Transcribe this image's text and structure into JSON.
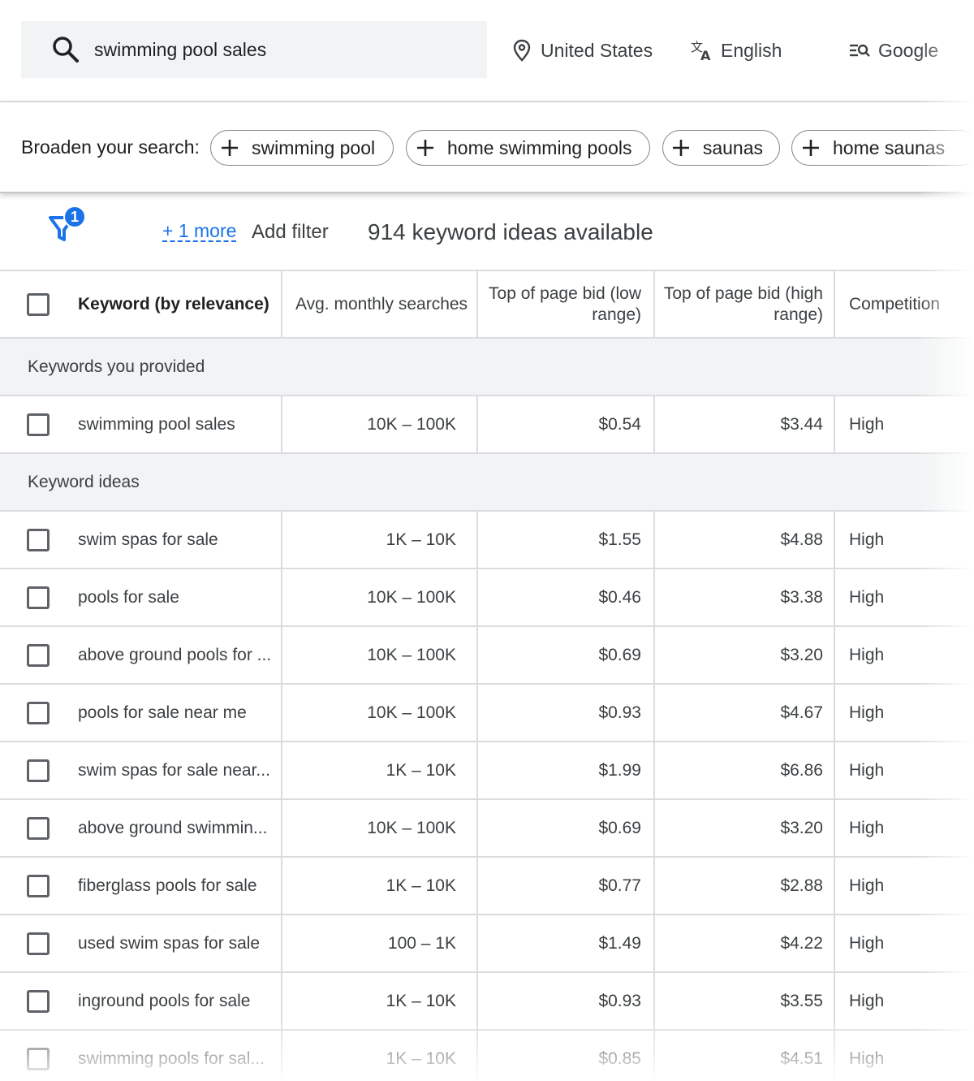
{
  "search": {
    "query": "swimming pool sales"
  },
  "topbar": {
    "location": "United States",
    "language": "English",
    "network": "Google"
  },
  "broaden": {
    "label": "Broaden your search:",
    "chips": [
      "swimming pool",
      "home swimming pools",
      "saunas",
      "home saunas"
    ]
  },
  "filters": {
    "badge_count": "1",
    "more_link": "+ 1 more",
    "add_filter": "Add filter",
    "ideas_count": "914 keyword ideas available"
  },
  "table": {
    "headers": {
      "keyword": "Keyword (by relevance)",
      "avg_searches": "Avg. monthly searches",
      "bid_low": "Top of page bid (low range)",
      "bid_high": "Top of page bid (high range)",
      "competition": "Competition"
    },
    "provided_section": "Keywords you provided",
    "provided": [
      {
        "keyword": "swimming pool sales",
        "avg": "10K – 100K",
        "low": "$0.54",
        "high": "$3.44",
        "comp": "High"
      }
    ],
    "ideas_section": "Keyword ideas",
    "ideas": [
      {
        "keyword": "swim spas for sale",
        "avg": "1K – 10K",
        "low": "$1.55",
        "high": "$4.88",
        "comp": "High"
      },
      {
        "keyword": "pools for sale",
        "avg": "10K – 100K",
        "low": "$0.46",
        "high": "$3.38",
        "comp": "High"
      },
      {
        "keyword": "above ground pools for ...",
        "avg": "10K – 100K",
        "low": "$0.69",
        "high": "$3.20",
        "comp": "High"
      },
      {
        "keyword": "pools for sale near me",
        "avg": "10K – 100K",
        "low": "$0.93",
        "high": "$4.67",
        "comp": "High"
      },
      {
        "keyword": "swim spas for sale near...",
        "avg": "1K – 10K",
        "low": "$1.99",
        "high": "$6.86",
        "comp": "High"
      },
      {
        "keyword": "above ground swimmin...",
        "avg": "10K – 100K",
        "low": "$0.69",
        "high": "$3.20",
        "comp": "High"
      },
      {
        "keyword": "fiberglass pools for sale",
        "avg": "1K – 10K",
        "low": "$0.77",
        "high": "$2.88",
        "comp": "High"
      },
      {
        "keyword": "used swim spas for sale",
        "avg": "100 – 1K",
        "low": "$1.49",
        "high": "$4.22",
        "comp": "High"
      },
      {
        "keyword": "inground pools for sale",
        "avg": "1K – 10K",
        "low": "$0.93",
        "high": "$3.55",
        "comp": "High"
      },
      {
        "keyword": "swimming pools for sal...",
        "avg": "1K – 10K",
        "low": "$0.85",
        "high": "$4.51",
        "comp": "High"
      }
    ]
  },
  "colors": {
    "accent": "#1a73e8",
    "section_bg": "#f1f3f4",
    "divider": "#dadce0"
  }
}
